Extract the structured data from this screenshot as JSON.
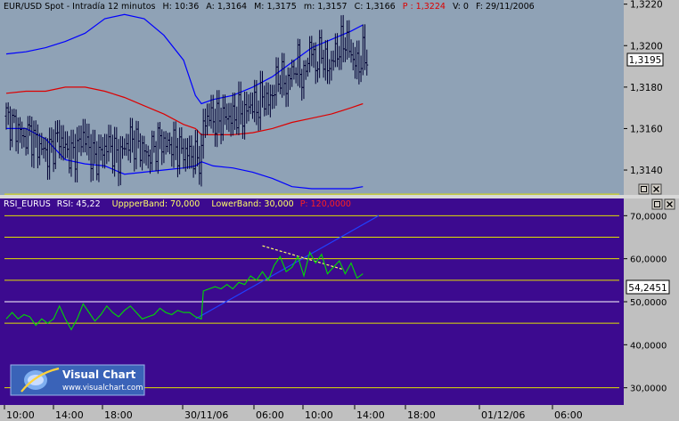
{
  "colors": {
    "price_bg": "#8fa2b6",
    "rsi_bg": "#3c0a8f",
    "axis_bg": "#c0c0c0",
    "price_bars": "#000033",
    "upper_lower_band": "#0000ff",
    "moving_average": "#dd0000",
    "rsi_line": "#00dd00",
    "level_yellow": "#e0e000",
    "level_white": "#ffffff",
    "trend_blue": "#2040ff",
    "trend_dotted": "#ffff66"
  },
  "price_panel": {
    "header": {
      "symbol": "EUR/USD Spot - Intradía 12 minutos",
      "h": "H: 10:36",
      "a": "A: 1,3164",
      "m": "M: 1,3175",
      "mn": "m: 1,3157",
      "c": "C: 1,3166",
      "p": "P : 1,3224",
      "v": "V: 0",
      "f": "F: 29/11/2006"
    },
    "last_value": "1,3195"
  },
  "rsi_panel": {
    "header": {
      "name": "RSI_EURUS",
      "rsi": "RSI: 45,22",
      "upper": "UppperBand: 70,000",
      "lower": "LowerBand: 30,000",
      "p": "P: 120,0000"
    },
    "last_value": "54,2451"
  },
  "logo": {
    "title": "Visual Chart",
    "url": "www.visualchart.com"
  },
  "chart_data": [
    {
      "type": "candlestick",
      "title": "EUR/USD Spot - Intradía 12 minutos",
      "ylim": [
        1.3128,
        1.3222
      ],
      "y_ticks": [
        "1,3140",
        "1,3160",
        "1,3180",
        "1,3200",
        "1,3220"
      ],
      "x_ticks": [
        "10:00",
        "14:00",
        "18:00",
        "30/11/06",
        "06:00",
        "10:00",
        "14:00",
        "18:00",
        "01/12/06",
        "06:00"
      ],
      "series": [
        {
          "name": "close",
          "x": [
            0,
            3,
            6,
            9,
            12,
            15,
            18,
            21,
            24,
            27,
            30,
            33,
            36,
            39,
            42,
            45,
            48,
            51,
            54,
            57,
            60,
            63,
            66,
            69,
            72,
            75,
            78,
            81,
            84,
            87,
            90,
            93,
            96,
            99,
            100,
            103,
            106,
            109,
            112,
            115,
            118,
            121,
            124,
            127,
            130,
            133,
            136,
            139,
            142,
            145,
            148,
            151,
            154,
            157,
            160,
            163,
            166,
            169,
            172,
            175,
            178,
            181
          ],
          "values": [
            1.3166,
            1.3162,
            1.316,
            1.3155,
            1.3158,
            1.3153,
            1.315,
            1.3148,
            1.3152,
            1.3156,
            1.315,
            1.3147,
            1.315,
            1.3157,
            1.315,
            1.3145,
            1.3148,
            1.3152,
            1.315,
            1.3146,
            1.3151,
            1.3155,
            1.3153,
            1.315,
            1.3147,
            1.3151,
            1.3155,
            1.3152,
            1.3153,
            1.315,
            1.3149,
            1.3148,
            1.3146,
            1.3146,
            1.3163,
            1.3166,
            1.3164,
            1.3164,
            1.3166,
            1.3165,
            1.3168,
            1.3167,
            1.3172,
            1.317,
            1.3176,
            1.3172,
            1.318,
            1.3186,
            1.3181,
            1.3187,
            1.3192,
            1.3183,
            1.32,
            1.3191,
            1.3197,
            1.3189,
            1.3194,
            1.3199,
            1.3203,
            1.3196,
            1.319,
            1.3195
          ]
        },
        {
          "name": "upper band",
          "x": [
            0,
            10,
            20,
            30,
            40,
            50,
            60,
            70,
            80,
            90,
            96,
            99,
            105,
            115,
            125,
            135,
            145,
            155,
            165,
            175,
            181
          ],
          "values": [
            1.3196,
            1.3197,
            1.3199,
            1.3202,
            1.3206,
            1.3213,
            1.3215,
            1.3213,
            1.3205,
            1.3193,
            1.3176,
            1.3172,
            1.3174,
            1.3176,
            1.318,
            1.3185,
            1.3192,
            1.3199,
            1.3203,
            1.3207,
            1.321
          ]
        },
        {
          "name": "moving average",
          "x": [
            0,
            10,
            20,
            30,
            40,
            50,
            60,
            70,
            80,
            90,
            96,
            99,
            105,
            115,
            125,
            135,
            145,
            155,
            165,
            175,
            181
          ],
          "values": [
            1.3177,
            1.3178,
            1.3178,
            1.318,
            1.318,
            1.3178,
            1.3175,
            1.3171,
            1.3167,
            1.3162,
            1.316,
            1.3157,
            1.3157,
            1.3157,
            1.3158,
            1.316,
            1.3163,
            1.3165,
            1.3167,
            1.317,
            1.3172
          ]
        },
        {
          "name": "lower band",
          "x": [
            0,
            10,
            20,
            30,
            40,
            50,
            60,
            70,
            80,
            90,
            96,
            99,
            105,
            115,
            125,
            135,
            145,
            155,
            165,
            175,
            181
          ],
          "values": [
            1.316,
            1.316,
            1.3155,
            1.3145,
            1.3143,
            1.3142,
            1.3138,
            1.3139,
            1.314,
            1.3141,
            1.3142,
            1.3144,
            1.3142,
            1.3141,
            1.3139,
            1.3136,
            1.3132,
            1.3131,
            1.3131,
            1.3131,
            1.3132
          ]
        }
      ]
    },
    {
      "type": "line",
      "title": "RSI_EURUS",
      "ylim": [
        26,
        74
      ],
      "y_ticks": [
        "30,0000",
        "40,0000",
        "50,0000",
        "60,0000",
        "70,0000"
      ],
      "x": [
        0,
        3,
        6,
        9,
        12,
        15,
        18,
        21,
        24,
        27,
        30,
        33,
        36,
        39,
        42,
        45,
        48,
        51,
        54,
        57,
        60,
        63,
        66,
        69,
        72,
        75,
        78,
        81,
        84,
        87,
        90,
        93,
        96,
        99,
        100,
        103,
        106,
        109,
        112,
        115,
        118,
        121,
        124,
        127,
        130,
        133,
        136,
        139,
        142,
        145,
        148,
        151,
        154,
        157,
        160,
        163,
        166,
        169,
        172,
        175,
        178,
        181
      ],
      "series": [
        {
          "name": "RSI",
          "values": [
            46,
            47.5,
            46,
            47,
            46.5,
            44.5,
            46,
            45,
            46,
            49,
            46,
            43.5,
            46,
            49.5,
            47.5,
            45.5,
            47,
            49,
            47.5,
            46.5,
            48,
            49,
            47.5,
            46,
            46.5,
            47,
            48.5,
            47.5,
            47,
            48,
            47.5,
            47.5,
            46.5,
            46,
            52.5,
            53,
            53.5,
            53,
            54,
            53,
            54.5,
            54,
            56,
            55,
            57,
            55,
            58.5,
            60.5,
            57,
            58,
            60.5,
            56,
            61.5,
            59,
            61,
            56.5,
            58,
            59.5,
            56.5,
            59,
            55.5,
            56.5
          ]
        }
      ],
      "levels": [
        {
          "value": 75,
          "color": "yellow"
        },
        {
          "value": 70,
          "color": "yellow"
        },
        {
          "value": 65,
          "color": "yellow"
        },
        {
          "value": 60,
          "color": "yellow"
        },
        {
          "value": 55,
          "color": "yellow"
        },
        {
          "value": 50,
          "color": "white"
        },
        {
          "value": 45,
          "color": "yellow"
        },
        {
          "value": 30,
          "color": "yellow"
        }
      ],
      "trendlines": [
        {
          "name": "rising trend",
          "x": [
            96,
            189
          ],
          "values": [
            46,
            70
          ]
        },
        {
          "name": "falling trend",
          "x": [
            130,
            171
          ],
          "values": [
            63,
            57.5
          ]
        }
      ]
    }
  ]
}
